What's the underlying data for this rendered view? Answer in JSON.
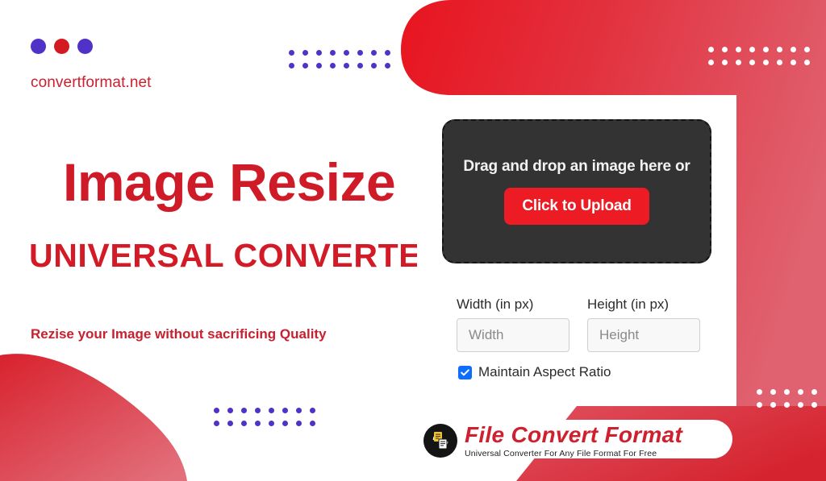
{
  "brand": {
    "name": "convertformat.net",
    "dots": [
      "purple",
      "red",
      "purple"
    ],
    "dot_colors": {
      "purple": "#5132c8",
      "red": "#d31a22"
    }
  },
  "hero": {
    "headline": "Image Resize",
    "subheadline": "UNIVERSAL CONVERTER",
    "tagline": "Rezise your Image without sacrificing Quality",
    "headline_color": "#cf1a27",
    "subheadline_color": "#d31b28",
    "tagline_color": "#c8202e"
  },
  "dropzone": {
    "instruction": "Drag and drop an image here or",
    "button_label": "Click to Upload",
    "button_color": "#ed1c24",
    "background_color": "#333333"
  },
  "form": {
    "width_field": {
      "label": "Width (in px)",
      "placeholder": "Width",
      "value": ""
    },
    "height_field": {
      "label": "Height (in px)",
      "placeholder": "Height",
      "value": ""
    },
    "aspect_ratio": {
      "label": "Maintain Aspect Ratio",
      "checked": true,
      "checkbox_color": "#0d6efd"
    }
  },
  "footer": {
    "logo_title": "File Convert Format",
    "logo_subtitle": "Universal Converter For Any File Format For Free",
    "logo_title_color": "#cf2030"
  },
  "decor": {
    "dot_grids": [
      {
        "name": "dots-top-left",
        "columns": 8,
        "rows": 2,
        "color": "#5132c8"
      },
      {
        "name": "dots-top-right",
        "columns": 8,
        "rows": 2,
        "color": "#ffffff"
      },
      {
        "name": "dots-bottom-left",
        "columns": 8,
        "rows": 2,
        "color": "#5132c8"
      },
      {
        "name": "dots-bottom-right",
        "columns": 5,
        "rows": 2,
        "color": "#ffffff"
      }
    ],
    "accent_red_dark": "#e01c26",
    "accent_red_light": "#e05260"
  }
}
